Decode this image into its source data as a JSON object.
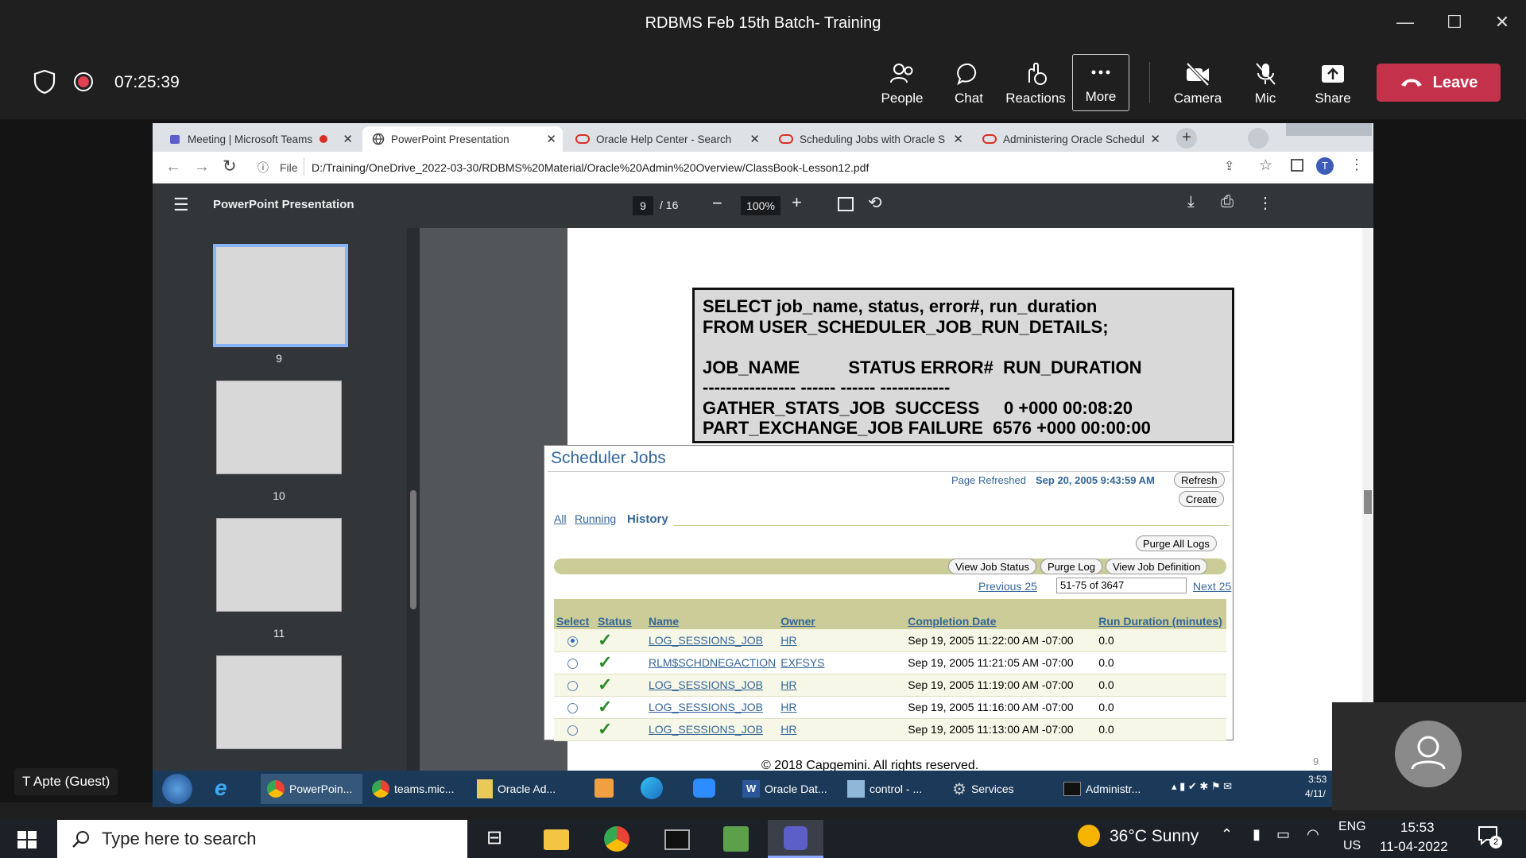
{
  "window": {
    "title": "RDBMS Feb 15th Batch- Training",
    "minimize": "—",
    "maximize": "☐",
    "close": "✕"
  },
  "meeting": {
    "timer": "07:25:39",
    "buttons": [
      {
        "label": "People",
        "icon": "people-icon"
      },
      {
        "label": "Chat",
        "icon": "chat-icon"
      },
      {
        "label": "Reactions",
        "icon": "reactions-icon"
      },
      {
        "label": "More",
        "icon": "more-icon"
      },
      {
        "label": "Camera",
        "icon": "camera-off-icon"
      },
      {
        "label": "Mic",
        "icon": "mic-off-icon"
      },
      {
        "label": "Share",
        "icon": "share-icon"
      }
    ],
    "leave_label": "Leave",
    "guest_label": "T Apte (Guest)"
  },
  "browser": {
    "tabs": [
      {
        "label": "Meeting | Microsoft Teams"
      },
      {
        "label": "PowerPoint Presentation"
      },
      {
        "label": "Oracle Help Center - Search"
      },
      {
        "label": "Scheduling Jobs with Oracle S"
      },
      {
        "label": "Administering Oracle Schedul"
      }
    ],
    "url_prefix": "File",
    "url": "D:/Training/OneDrive_2022-03-30/RDBMS%20Material/Oracle%20Admin%20Overview/ClassBook-Lesson12.pdf",
    "profile_initial": "T"
  },
  "pdf": {
    "title": "PowerPoint Presentation",
    "page_current": "9",
    "page_total": "/ 16",
    "zoom": "100%",
    "thumbnails": [
      "9",
      "10",
      "11"
    ],
    "page_number": "9",
    "footer": "© 2018 Capgemini. All rights reserved."
  },
  "sql": {
    "text": "SELECT job_name, status, error#, run_duration\nFROM USER_SCHEDULER_JOB_RUN_DETAILS;\n\nJOB_NAME          STATUS ERROR#  RUN_DURATION\n---------------- ------ ------ ------------\nGATHER_STATS_JOB  SUCCESS     0 +000 00:08:20\nPART_EXCHANGE_JOB FAILURE  6576 +000 00:00:00"
  },
  "scheduler": {
    "title": "Scheduler Jobs",
    "refreshed_label": "Page Refreshed",
    "refreshed_value": "Sep 20, 2005 9:43:59 AM",
    "refresh_btn": "Refresh",
    "create_btn": "Create",
    "tabs": [
      "All",
      "Running",
      "History"
    ],
    "purge_all": "Purge All Logs",
    "view_status": "View Job Status",
    "purge_log": "Purge Log",
    "view_def": "View Job Definition",
    "previous": "Previous 25",
    "range": "51-75 of 3647",
    "next": "Next 25",
    "columns": [
      "Select",
      "Status",
      "Name",
      "Owner",
      "Completion Date",
      "Run Duration (minutes)"
    ],
    "rows": [
      {
        "name": "LOG_SESSIONS_JOB",
        "owner": "HR",
        "date": "Sep 19, 2005 11:22:00 AM -07:00",
        "dur": "0.0"
      },
      {
        "name": "RLM$SCHDNEGACTION",
        "owner": "EXFSYS",
        "date": "Sep 19, 2005 11:21:05 AM -07:00",
        "dur": "0.0"
      },
      {
        "name": "LOG_SESSIONS_JOB",
        "owner": "HR",
        "date": "Sep 19, 2005 11:19:00 AM -07:00",
        "dur": "0.0"
      },
      {
        "name": "LOG_SESSIONS_JOB",
        "owner": "HR",
        "date": "Sep 19, 2005 11:16:00 AM -07:00",
        "dur": "0.0"
      },
      {
        "name": "LOG_SESSIONS_JOB",
        "owner": "HR",
        "date": "Sep 19, 2005 11:13:00 AM -07:00",
        "dur": "0.0"
      }
    ]
  },
  "remote_taskbar": {
    "items": [
      "PowerPoin...",
      "teams.mic...",
      "Oracle Ad...",
      "Oracle Dat...",
      "control - ...",
      "Services",
      "Administr..."
    ],
    "clock": "3:53",
    "date": "4/11/"
  },
  "taskbar": {
    "search_placeholder": "Type here to search",
    "weather": "36°C  Sunny",
    "lang1": "ENG",
    "lang2": "US",
    "time": "15:53",
    "date": "11-04-2022",
    "notif": "2"
  }
}
